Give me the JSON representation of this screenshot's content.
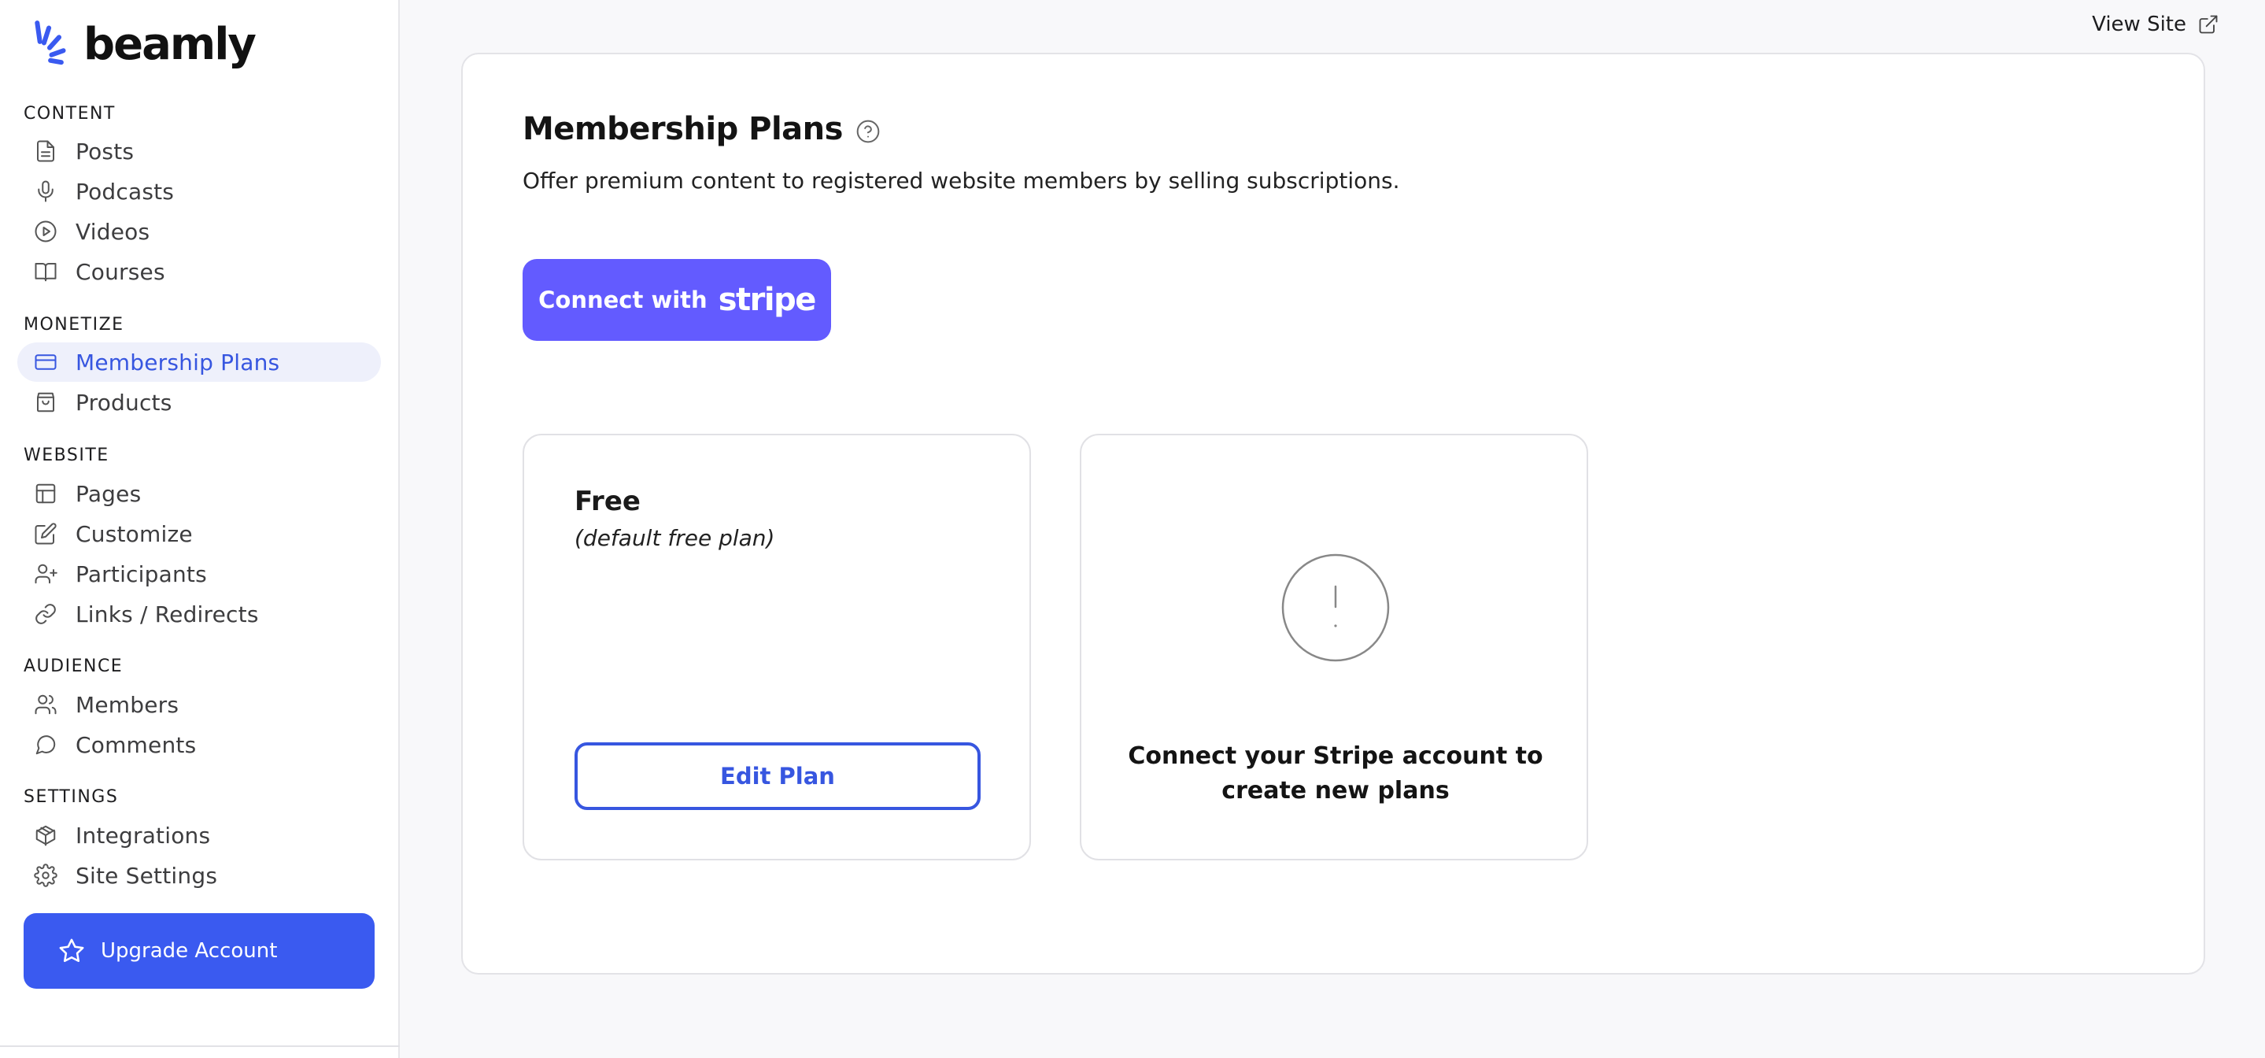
{
  "brand": {
    "name": "beamly",
    "accent": "#3a5af0"
  },
  "header": {
    "view_site_label": "View Site"
  },
  "sidebar": {
    "sections": [
      {
        "label": "CONTENT",
        "items": [
          {
            "label": "Posts",
            "icon": "file-text-icon"
          },
          {
            "label": "Podcasts",
            "icon": "microphone-icon"
          },
          {
            "label": "Videos",
            "icon": "play-circle-icon"
          },
          {
            "label": "Courses",
            "icon": "book-open-icon"
          }
        ]
      },
      {
        "label": "MONETIZE",
        "items": [
          {
            "label": "Membership Plans",
            "icon": "credit-card-icon",
            "active": true
          },
          {
            "label": "Products",
            "icon": "shopping-bag-icon"
          }
        ]
      },
      {
        "label": "WEBSITE",
        "items": [
          {
            "label": "Pages",
            "icon": "layout-icon"
          },
          {
            "label": "Customize",
            "icon": "edit-icon"
          },
          {
            "label": "Participants",
            "icon": "user-plus-icon"
          },
          {
            "label": "Links / Redirects",
            "icon": "link-icon"
          }
        ]
      },
      {
        "label": "AUDIENCE",
        "items": [
          {
            "label": "Members",
            "icon": "users-icon"
          },
          {
            "label": "Comments",
            "icon": "message-circle-icon"
          }
        ]
      },
      {
        "label": "SETTINGS",
        "items": [
          {
            "label": "Integrations",
            "icon": "package-icon"
          },
          {
            "label": "Site Settings",
            "icon": "gear-icon"
          }
        ]
      }
    ],
    "upgrade_label": "Upgrade Account"
  },
  "main": {
    "title": "Membership Plans",
    "subtitle": "Offer premium content to registered website members by selling subscriptions.",
    "stripe_button": {
      "prefix": "Connect with",
      "brand": "stripe",
      "color": "#635bff"
    },
    "plans": {
      "free": {
        "name": "Free",
        "description": "(default free plan)",
        "edit_label": "Edit Plan"
      },
      "connect_prompt": "Connect your Stripe account to create new plans"
    }
  }
}
